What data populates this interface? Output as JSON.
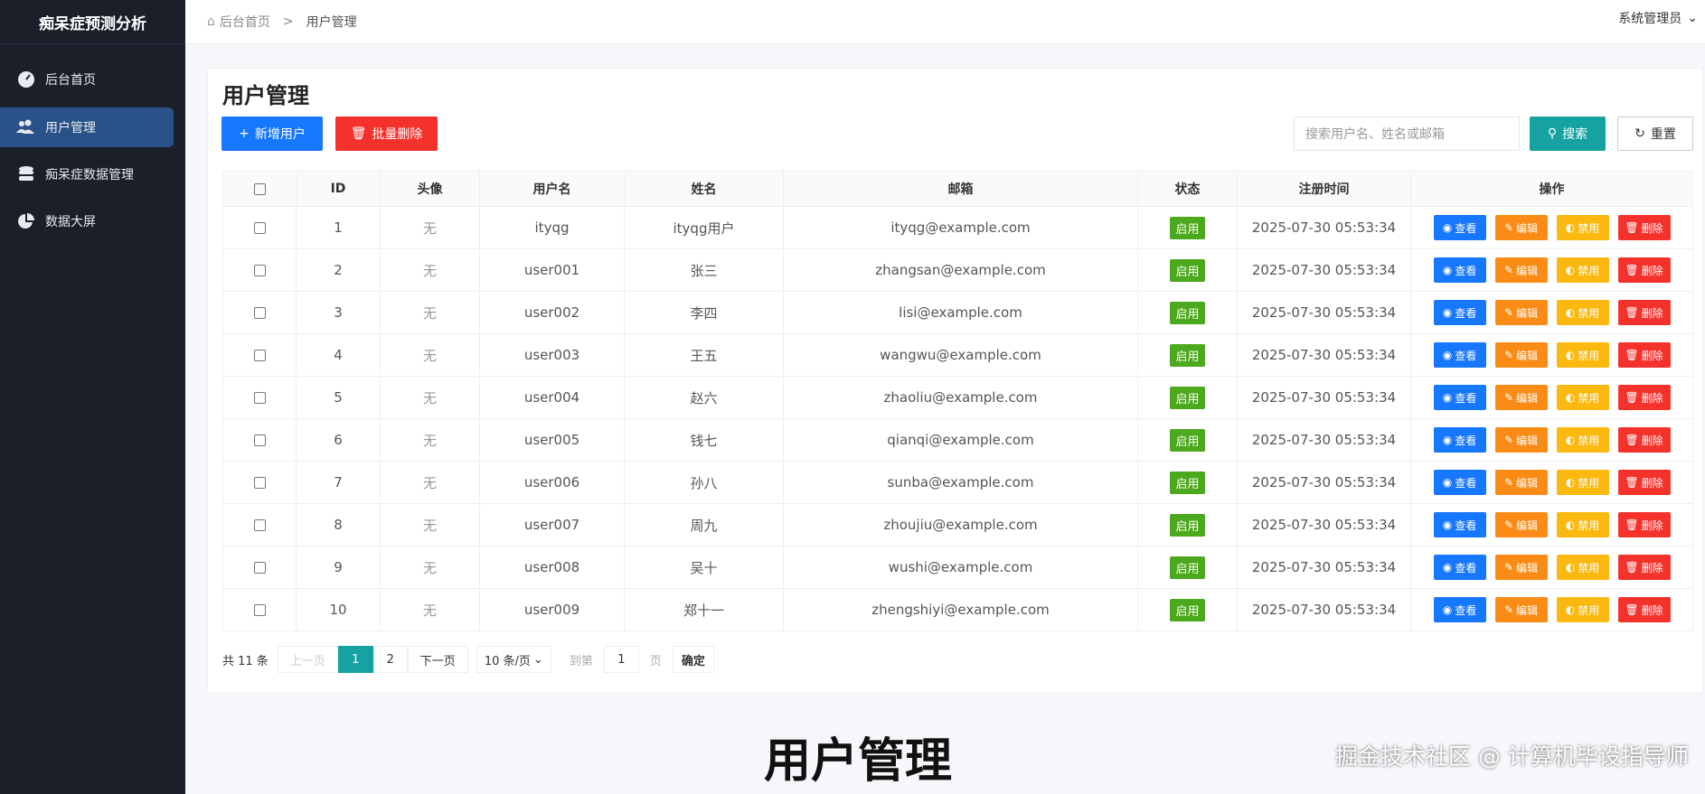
{
  "sidebar": {
    "brand": "痴呆症预测分析",
    "items": [
      {
        "label": "后台首页",
        "icon": "dashboard-icon"
      },
      {
        "label": "用户管理",
        "icon": "users-icon"
      },
      {
        "label": "痴呆症数据管理",
        "icon": "database-icon"
      },
      {
        "label": "数据大屏",
        "icon": "pie-chart-icon"
      }
    ]
  },
  "header": {
    "breadcrumb": [
      "后台首页",
      "用户管理"
    ],
    "separator": ">",
    "user": "系统管理员"
  },
  "page": {
    "title": "用户管理",
    "add_label": "新增用户",
    "batch_delete_label": "批量删除",
    "search_placeholder": "搜索用户名、姓名或邮箱",
    "search_label": "搜索",
    "reset_label": "重置"
  },
  "table": {
    "columns": [
      "ID",
      "头像",
      "用户名",
      "姓名",
      "邮箱",
      "状态",
      "注册时间",
      "操作"
    ],
    "rows": [
      {
        "id": "1",
        "avatar": "无",
        "username": "ityqg",
        "name": "ityqg用户",
        "email": "ityqg@example.com",
        "status": "启用",
        "time": "2025-07-30 05:53:34"
      },
      {
        "id": "2",
        "avatar": "无",
        "username": "user001",
        "name": "张三",
        "email": "zhangsan@example.com",
        "status": "启用",
        "time": "2025-07-30 05:53:34"
      },
      {
        "id": "3",
        "avatar": "无",
        "username": "user002",
        "name": "李四",
        "email": "lisi@example.com",
        "status": "启用",
        "time": "2025-07-30 05:53:34"
      },
      {
        "id": "4",
        "avatar": "无",
        "username": "user003",
        "name": "王五",
        "email": "wangwu@example.com",
        "status": "启用",
        "time": "2025-07-30 05:53:34"
      },
      {
        "id": "5",
        "avatar": "无",
        "username": "user004",
        "name": "赵六",
        "email": "zhaoliu@example.com",
        "status": "启用",
        "time": "2025-07-30 05:53:34"
      },
      {
        "id": "6",
        "avatar": "无",
        "username": "user005",
        "name": "钱七",
        "email": "qianqi@example.com",
        "status": "启用",
        "time": "2025-07-30 05:53:34"
      },
      {
        "id": "7",
        "avatar": "无",
        "username": "user006",
        "name": "孙八",
        "email": "sunba@example.com",
        "status": "启用",
        "time": "2025-07-30 05:53:34"
      },
      {
        "id": "8",
        "avatar": "无",
        "username": "user007",
        "name": "周九",
        "email": "zhoujiu@example.com",
        "status": "启用",
        "time": "2025-07-30 05:53:34"
      },
      {
        "id": "9",
        "avatar": "无",
        "username": "user008",
        "name": "吴十",
        "email": "wushi@example.com",
        "status": "启用",
        "time": "2025-07-30 05:53:34"
      },
      {
        "id": "10",
        "avatar": "无",
        "username": "user009",
        "name": "郑十一",
        "email": "zhengshiyi@example.com",
        "status": "启用",
        "time": "2025-07-30 05:53:34"
      }
    ],
    "actions": {
      "view": "查看",
      "edit": "编辑",
      "disable": "禁用",
      "delete": "删除"
    }
  },
  "pagination": {
    "total": "共 11 条",
    "prev": "上一页",
    "pages": [
      "1",
      "2"
    ],
    "current": "1",
    "next": "下一页",
    "page_size": "10 条/页",
    "goto_label": "到第",
    "goto_value": "1",
    "page_unit": "页",
    "confirm": "确定"
  },
  "overlay": {
    "caption": "用户管理",
    "watermark": "掘金技术社区 @ 计算机毕设指导师"
  },
  "colors": {
    "primary": "#1677ff",
    "danger": "#f5312c",
    "teal": "#17a2a2",
    "orange": "#fa8c16",
    "yellow": "#fbb80f",
    "green": "#4ca81c"
  }
}
